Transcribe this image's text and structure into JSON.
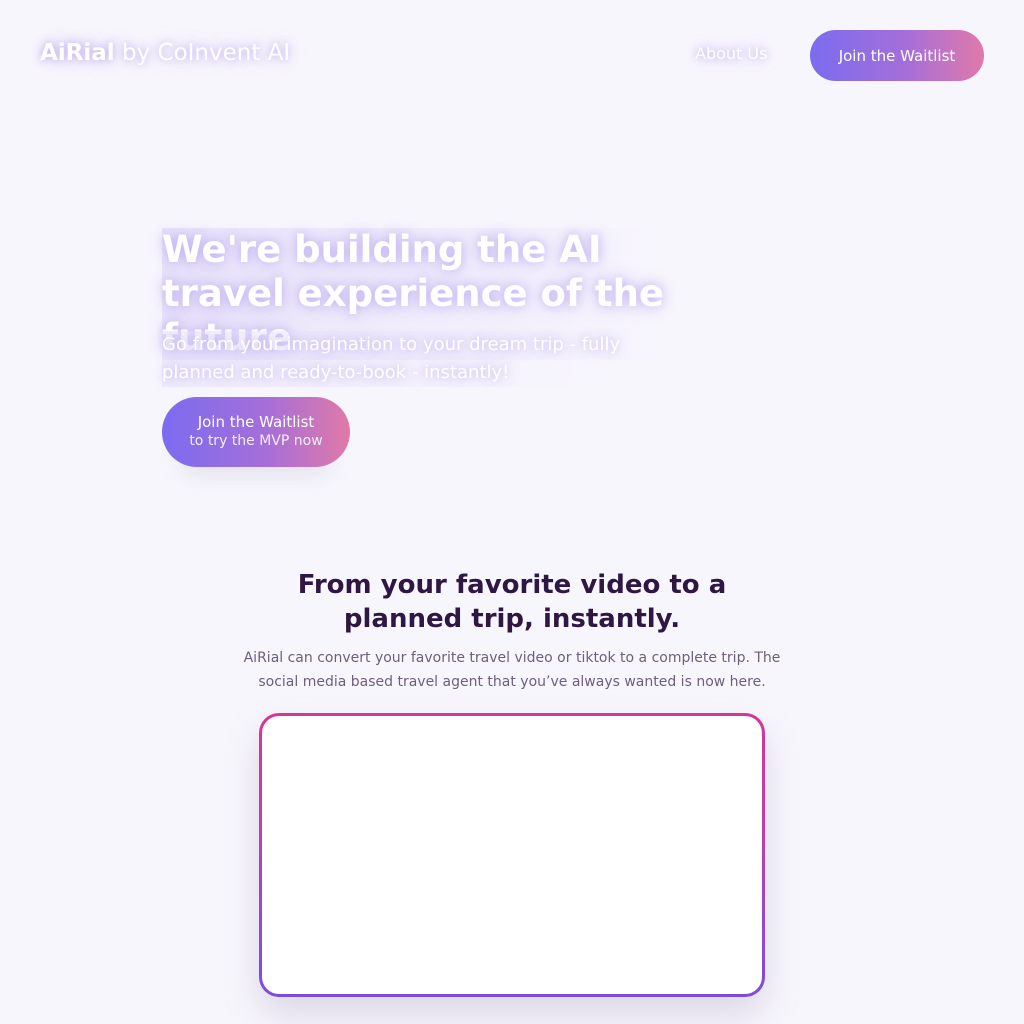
{
  "header": {
    "brand_name": "AiRial",
    "brand_sub": " by CoInvent AI",
    "nav_about": "About Us",
    "nav_join": "Join the Waitlist"
  },
  "hero": {
    "title": "We're building the AI travel experience of the future",
    "subtitle": "Go from your imagination to your dream trip - fully planned and ready-to-book - instantly!",
    "cta_line1": "Join the Waitlist",
    "cta_line2": "to try the MVP now"
  },
  "section": {
    "title": "From your favorite video to a planned trip, instantly.",
    "description": "AiRial can convert your favorite travel video or tiktok to a complete trip. The social media based travel agent that you’ve always wanted is now here."
  },
  "colors": {
    "background": "#f8f6fd",
    "gradient_start": "#7b6cf0",
    "gradient_end": "#e07aa8",
    "heading_dark": "#2e1743",
    "frame_top": "#d63596",
    "frame_bottom": "#7a4de0"
  }
}
